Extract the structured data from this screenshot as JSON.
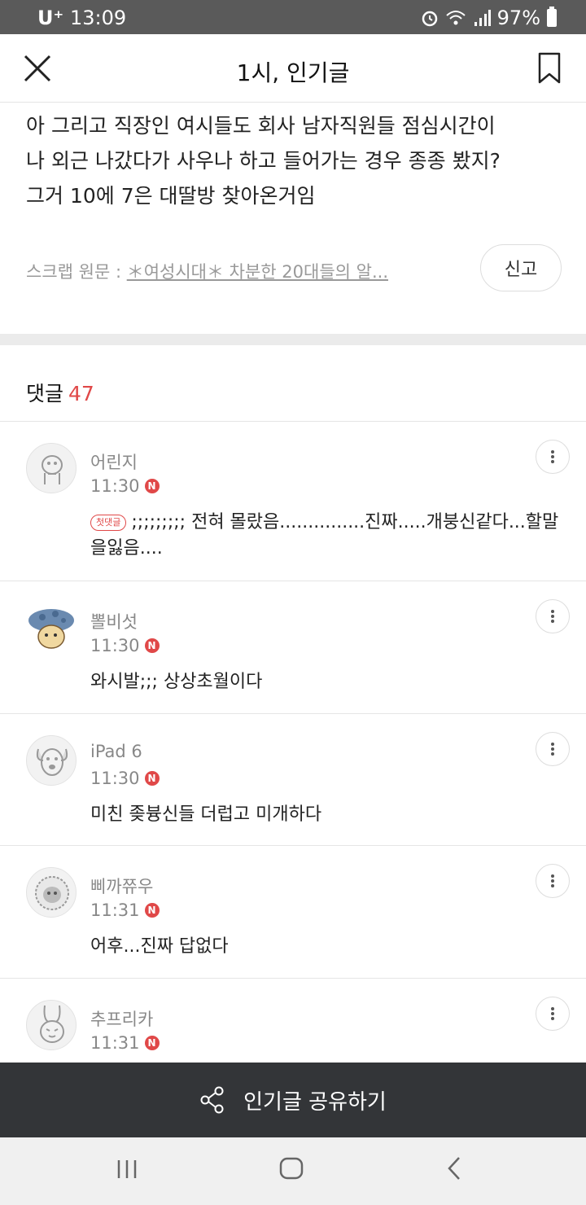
{
  "status_bar": {
    "carrier": "U⁺",
    "time": "13:09",
    "battery": "97%"
  },
  "header": {
    "title": "1시, 인기글"
  },
  "post": {
    "text_lines": [
      "아 그리고 직장인 여시들도 회사 남자직원들 점심시간이",
      "나 외근 나갔다가 사우나 하고 들어가는 경우 종종 봤지?",
      "그거 10에 7은 대딸방 찾아온거임"
    ],
    "scrap_label": "스크랩 원문 : ",
    "scrap_link": "＊여성시대＊ 차분한 20대들의 알...",
    "report_label": "신고"
  },
  "comments_section": {
    "label": "댓글",
    "count": "47"
  },
  "comments": [
    {
      "nick": "어린지",
      "time": "11:30",
      "badge": "N",
      "first_badge": "첫댓글",
      "text": ";;;;;;;;; 전혀 몰랐음...............진짜.....개붕신같다...할말을잃음...."
    },
    {
      "nick": "뽈비섯",
      "time": "11:30",
      "badge": "N",
      "text": "와시발;;; 상상초월이다"
    },
    {
      "nick": "iPad 6",
      "time": "11:30",
      "badge": "N",
      "text": "미친 좆븅신들 더럽고 미개하다"
    },
    {
      "nick": "삐까쮸우",
      "time": "11:31",
      "badge": "N",
      "text": "어후...진짜 답없다"
    },
    {
      "nick": "추프리카",
      "time": "11:31",
      "badge": "N",
      "text": ""
    }
  ],
  "share_bar": {
    "label": "인기글 공유하기"
  },
  "colors": {
    "accent_red": "#e04848",
    "share_bar_bg": "#333538",
    "status_bar_bg": "#5a5a5a"
  },
  "icons": [
    "close-icon",
    "bookmark-icon",
    "more-vertical-icon",
    "share-icon",
    "recent-apps-icon",
    "home-icon",
    "back-icon"
  ]
}
